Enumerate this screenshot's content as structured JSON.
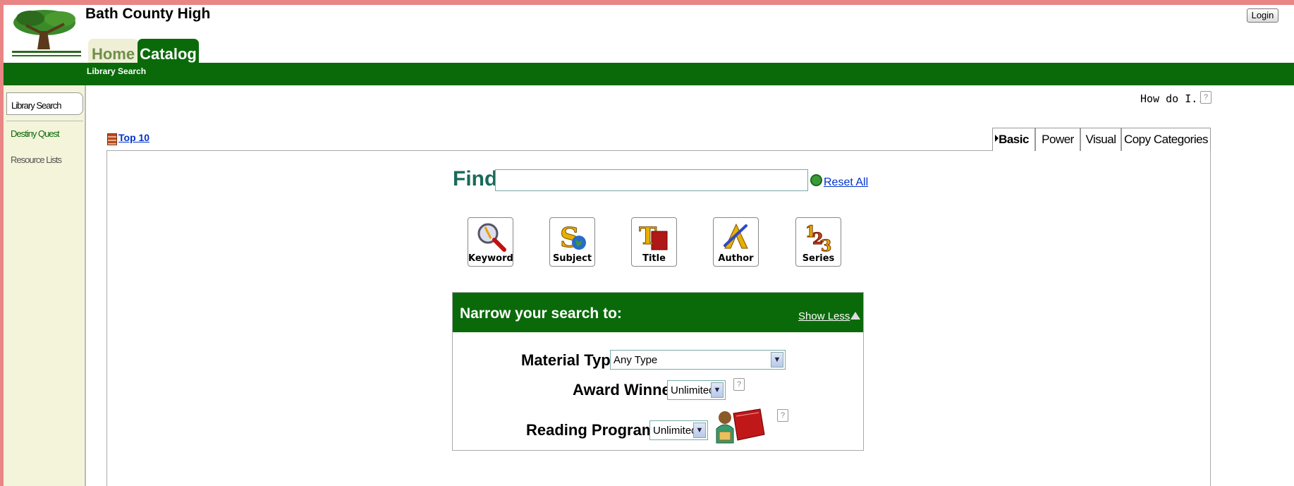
{
  "header": {
    "school_name": "Bath County High",
    "login_label": "Login",
    "tabs": [
      {
        "label": "Home"
      },
      {
        "label": "Catalog"
      }
    ],
    "subnav_label": "Library Search"
  },
  "sidebar": {
    "items": [
      {
        "label": "Library Search"
      },
      {
        "label": "Destiny Quest"
      },
      {
        "label": "Resource Lists"
      }
    ]
  },
  "help": {
    "how_do_i_label": "How do I...",
    "help_glyph": "?"
  },
  "top10": {
    "label": "Top 10"
  },
  "search_tabs": [
    {
      "label": "Basic"
    },
    {
      "label": "Power"
    },
    {
      "label": "Visual"
    },
    {
      "label": "Copy Categories"
    }
  ],
  "find": {
    "label": "Find",
    "value": "",
    "reset_label": " Reset All"
  },
  "search_buttons": [
    {
      "label": "Keyword",
      "icon": "magnifier-icon"
    },
    {
      "label": "Subject",
      "icon": "subject-globe-icon"
    },
    {
      "label": "Title",
      "icon": "title-book-icon"
    },
    {
      "label": "Author",
      "icon": "author-pen-icon"
    },
    {
      "label": "Series",
      "icon": "series-123-icon"
    }
  ],
  "narrow": {
    "title": "Narrow your search to:",
    "show_less_label": "Show Less",
    "material_type": {
      "label": "Material Type",
      "value": "Any Type"
    },
    "award_winner": {
      "label": "Award Winner",
      "value": "Unlimited"
    },
    "reading_programs": {
      "label": "Reading Programs",
      "value": "Unlimited"
    }
  },
  "colors": {
    "brand_green": "#0a6a0a",
    "page_border": "#e98585",
    "link_blue": "#0033cc"
  }
}
